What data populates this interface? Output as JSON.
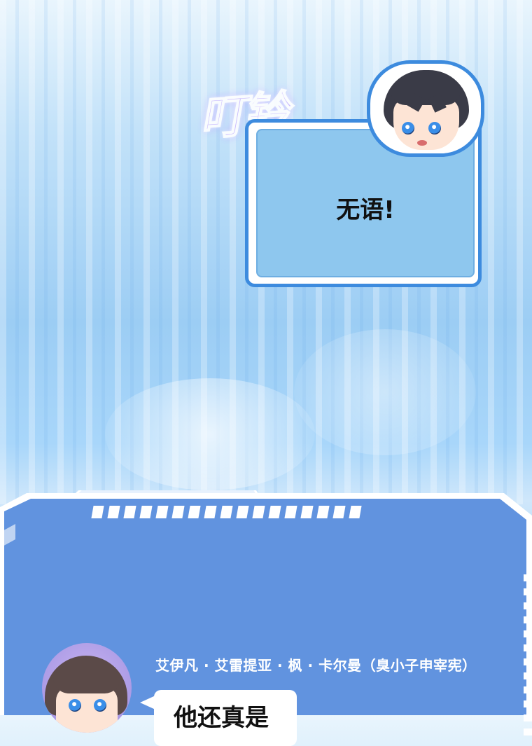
{
  "sfx_text": "叮铃",
  "speech_top": "无语!",
  "speaker_label": "艾伊凡 · 艾雷提亚 · 枫 · 卡尔曼（臭小子申宰宪）",
  "speech_bottom": "他还真是",
  "colors": {
    "frame_blue": "#3d8bde",
    "hud_blue": "#6193df",
    "bubble_fill": "#8ec7ee"
  },
  "icons": {
    "top_avatar": "chibi-boy-annoyed-icon",
    "bottom_avatar": "chibi-boy-portrait-icon"
  }
}
